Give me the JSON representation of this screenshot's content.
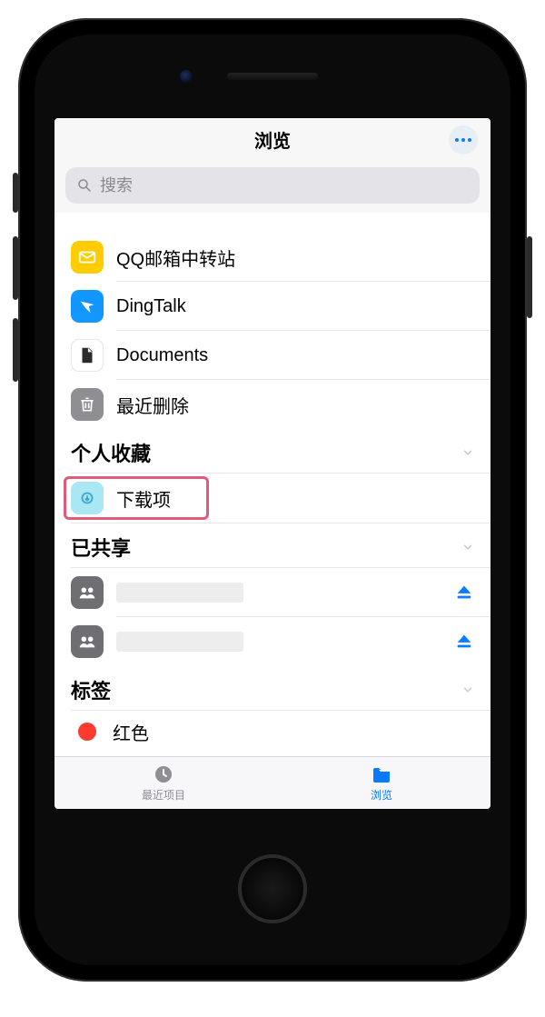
{
  "nav": {
    "title": "浏览"
  },
  "search": {
    "placeholder": "搜索"
  },
  "locations": [
    {
      "label": "QQ邮箱中转站",
      "icon": "mail-icon"
    },
    {
      "label": "DingTalk",
      "icon": "dingtalk-icon"
    },
    {
      "label": "Documents",
      "icon": "documents-icon"
    },
    {
      "label": "最近删除",
      "icon": "trash-icon"
    }
  ],
  "sections": {
    "favorites": {
      "title": "个人收藏",
      "items": [
        {
          "label": "下载项",
          "icon": "downloads-folder-icon"
        }
      ]
    },
    "shared": {
      "title": "已共享",
      "items": [
        {
          "label": "",
          "icon": "shared-group-icon",
          "eject": true
        },
        {
          "label": "",
          "icon": "shared-group-icon",
          "eject": true
        }
      ]
    },
    "tags": {
      "title": "标签",
      "items": [
        {
          "label": "红色",
          "color": "#ff3b30"
        }
      ]
    }
  },
  "tabs": {
    "recent": "最近项目",
    "browse": "浏览"
  },
  "colors": {
    "accent": "#0a7aff",
    "highlight_border": "#e05a7a"
  }
}
